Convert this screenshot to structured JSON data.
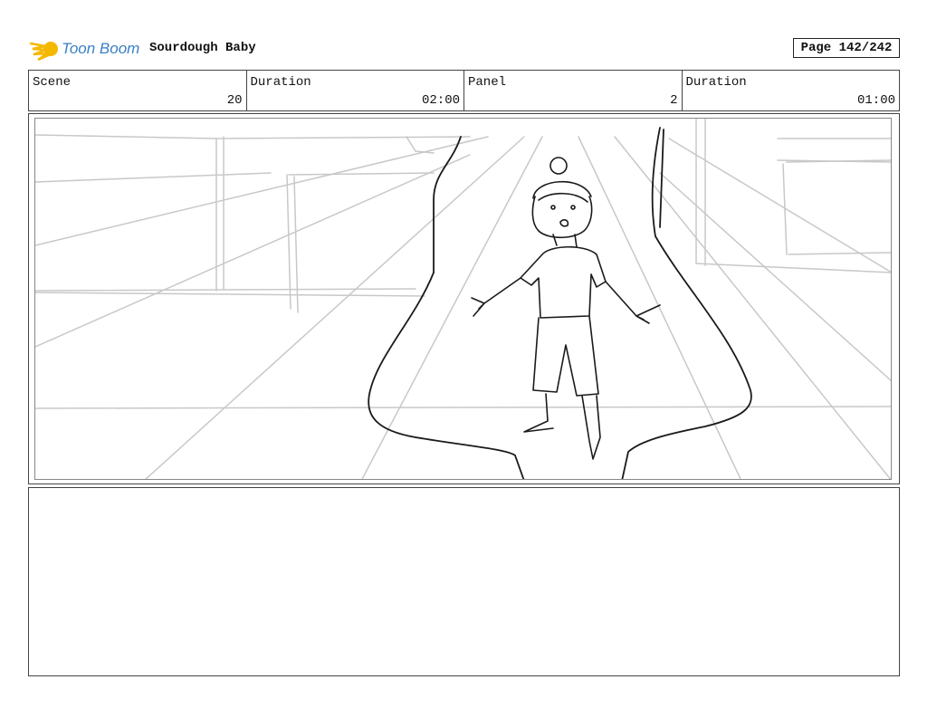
{
  "header": {
    "brand": "Toon Boom",
    "logo_icon": "toon-boom-comet-logo",
    "title": "Sourdough Baby",
    "page": "Page 142/242"
  },
  "info": {
    "scene_label": "Scene",
    "scene_value": "20",
    "scene_duration_label": "Duration",
    "scene_duration_value": "02:00",
    "panel_label": "Panel",
    "panel_value": "2",
    "panel_duration_label": "Duration",
    "panel_duration_value": "01:00"
  },
  "notes": {
    "text": ""
  },
  "colors": {
    "brand_blue": "#3a7fc4",
    "logo_yellow": "#f5b800"
  }
}
